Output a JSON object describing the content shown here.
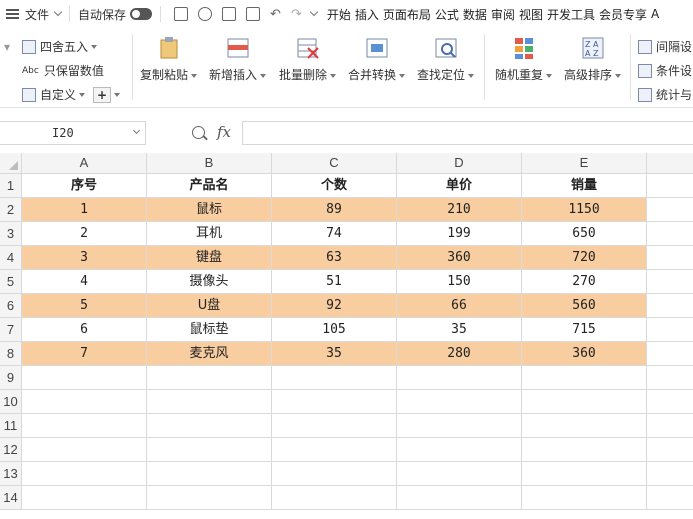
{
  "menubar": {
    "file_label": "文件",
    "autosave_label": "自动保存",
    "tabs": [
      "开始",
      "插入",
      "页面布局",
      "公式",
      "数据",
      "审阅",
      "视图",
      "开发工具",
      "会员专享",
      "A"
    ]
  },
  "ribbon": {
    "round_label": "四舍五入",
    "keep_value_label": "只保留数值",
    "custom_label": "自定义",
    "big_buttons": [
      "复制粘贴",
      "新增插入",
      "批量删除",
      "合并转换",
      "查找定位",
      "随机重复",
      "高级排序"
    ],
    "right_items": [
      "间隔设",
      "条件设",
      "统计与"
    ]
  },
  "formula_bar": {
    "cell_ref": "I20",
    "fx_label": "fx",
    "formula_value": ""
  },
  "grid": {
    "columns": [
      "A",
      "B",
      "C",
      "D",
      "E"
    ],
    "row_numbers": [
      "1",
      "2",
      "3",
      "4",
      "5",
      "6",
      "7",
      "8",
      "9",
      "10",
      "11",
      "12",
      "13",
      "14"
    ],
    "header": [
      "序号",
      "产品名",
      "个数",
      "单价",
      "销量"
    ],
    "rows": [
      [
        "1",
        "鼠标",
        "89",
        "210",
        "1150"
      ],
      [
        "2",
        "耳机",
        "74",
        "199",
        "650"
      ],
      [
        "3",
        "键盘",
        "63",
        "360",
        "720"
      ],
      [
        "4",
        "摄像头",
        "51",
        "150",
        "270"
      ],
      [
        "5",
        "U盘",
        "92",
        "66",
        "560"
      ],
      [
        "6",
        "鼠标垫",
        "105",
        "35",
        "715"
      ],
      [
        "7",
        "麦克风",
        "35",
        "280",
        "360"
      ]
    ],
    "band_color": "#f8cda0"
  }
}
